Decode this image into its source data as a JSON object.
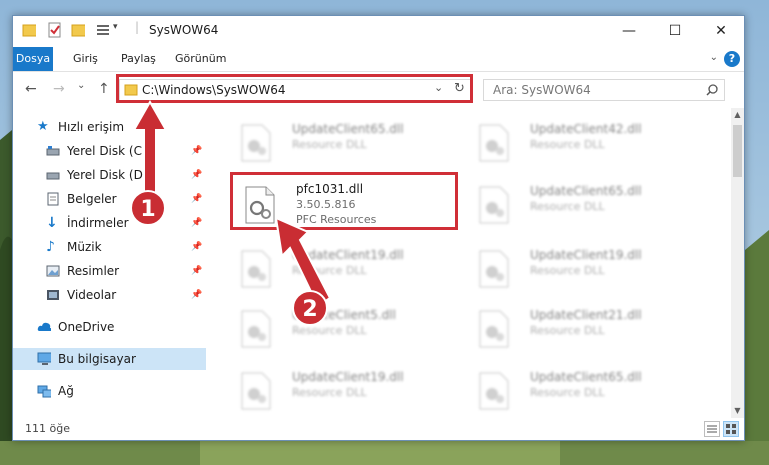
{
  "window": {
    "title": "SysWOW64",
    "controls": {
      "minimize": "—",
      "maximize": "☐",
      "close": "✕"
    }
  },
  "ribbon": {
    "tabs": [
      "Dosya",
      "Giriş",
      "Paylaş",
      "Görünüm"
    ],
    "help": "?"
  },
  "navigation": {
    "back": "←",
    "forward": "→",
    "recent": "⌄",
    "up": "↑",
    "address": "C:\\Windows\\SysWOW64",
    "search_placeholder": "Ara: SysWOW64"
  },
  "sidebar": {
    "items": [
      {
        "label": "Hızlı erişim",
        "icon": "star-icon"
      },
      {
        "label": "Yerel Disk (C:)",
        "icon": "drive-icon",
        "pinned": true
      },
      {
        "label": "Yerel Disk (D:)",
        "icon": "drive-icon",
        "pinned": true
      },
      {
        "label": "Belgeler",
        "icon": "document-icon",
        "pinned": true
      },
      {
        "label": "İndirmeler",
        "icon": "download-icon",
        "pinned": true
      },
      {
        "label": "Müzik",
        "icon": "music-icon",
        "pinned": true
      },
      {
        "label": "Resimler",
        "icon": "pictures-icon",
        "pinned": true
      },
      {
        "label": "Videolar",
        "icon": "video-icon",
        "pinned": true
      },
      {
        "label": "OneDrive",
        "icon": "cloud-icon"
      },
      {
        "label": "Bu bilgisayar",
        "icon": "computer-icon",
        "selected": true
      },
      {
        "label": "Ağ",
        "icon": "network-icon"
      }
    ]
  },
  "files": [
    {
      "name": "UpdateClient65.dll",
      "desc": "Resource DLL",
      "blurred": true
    },
    {
      "name": "UpdateClient42.dll",
      "desc": "Resource DLL",
      "blurred": true
    },
    {
      "name": "pfc1031.dll",
      "version": "3.50.5.816",
      "desc": "PFC Resources",
      "blurred": false
    },
    {
      "name": "UpdateClient65.dll",
      "desc": "Resource DLL",
      "blurred": true
    },
    {
      "name": "UpdateClient19.dll",
      "desc": "Resource DLL",
      "blurred": true
    },
    {
      "name": "UpdateClient19.dll",
      "desc": "Resource DLL",
      "blurred": true
    },
    {
      "name": "UpdateClient5.dll",
      "desc": "Resource DLL",
      "blurred": true
    },
    {
      "name": "UpdateClient21.dll",
      "desc": "Resource DLL",
      "blurred": true
    },
    {
      "name": "UpdateClient19.dll",
      "desc": "Resource DLL",
      "blurred": true
    },
    {
      "name": "UpdateClient65.dll",
      "desc": "Resource DLL",
      "blurred": true
    }
  ],
  "status": {
    "item_count": "111 öğe"
  },
  "annotations": {
    "step1": "1",
    "step2": "2"
  },
  "colors": {
    "accent": "#1979ca",
    "highlight": "#d02f37",
    "selected": "#cce4f7"
  }
}
